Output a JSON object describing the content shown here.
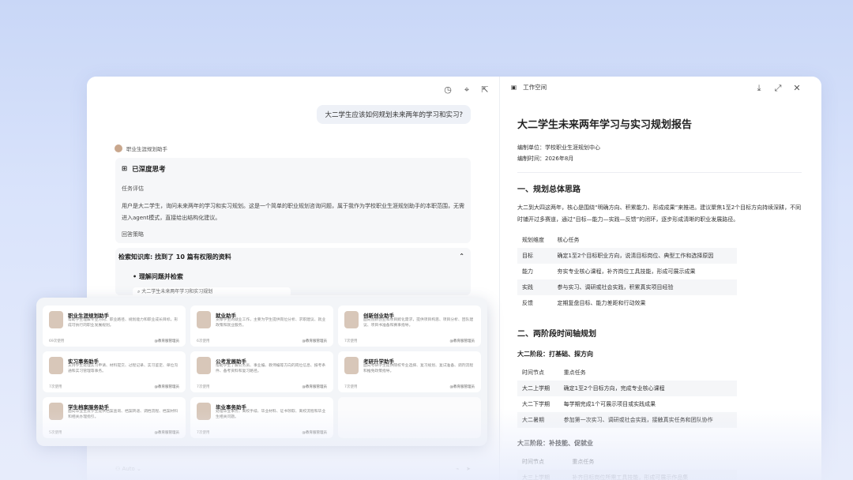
{
  "chat": {
    "user_message": "大二学生应该如何规划未来两年的学习和实习?",
    "assistant_name": "职业生涯规划助手",
    "think_title": "已深度思考",
    "task_label": "任务评估",
    "task_text": "用户是大二学生，询问未来两年的学习和实习规划。这是一个简单的职业规划咨询问题，属于我作为学校职业生涯规划助手的本职范围，无需进入agent模式，直接给出结构化建议。",
    "strategy_label": "回答策略",
    "kb_prefix": "检索知识库:",
    "kb_result": "找到了 10 篇有权限的资料",
    "kb_step": "理解问题并检索",
    "kb_query": "大二学生未来两年学习和实习规划",
    "composer_mode": "Auto"
  },
  "assistants": [
    {
      "name": "职业生涯规划助手",
      "desc": "帮助学生理解专业方向、职业路径、规划能力和职业成长目标，形成可执行的职业发展规划。",
      "meta": "69次使用",
      "tag": "@教育服管理员"
    },
    {
      "name": "就业助手",
      "desc": "支撑学生的就业工作，主要为学生提供岗位分析、求职建议、就业政策和就业服务。",
      "meta": "6次使用",
      "tag": "@教育服管理员"
    },
    {
      "name": "创新创业助手",
      "desc": "面向创新创业和项目孵化需求，提供项目构思、项目分析、团队建议、项目书准备和赛事指导。",
      "meta": "7次使用",
      "tag": "@教育服管理员"
    },
    {
      "name": "实习事务助手",
      "desc": "支持学生处理实习申请、材料提交、过程记录、实习鉴定、单位沟通和实习管理等事务。",
      "meta": "7次使用",
      "tag": "@教育服管理员"
    },
    {
      "name": "公考发展助手",
      "desc": "帮助学生了解公务员、事业编、教师编等方向的岗位信息、报考条件、备考资料和复习路径。",
      "meta": "7次使用",
      "tag": "@教育服管理员"
    },
    {
      "name": "考研升学助手",
      "desc": "面向考研学生提供院校专业选择、复习规划、复试准备、调剂流程和推免政策指导。",
      "meta": "7次使用",
      "tag": "@教育服管理员"
    },
    {
      "name": "学生档案服务助手",
      "desc": "面向毕业生及学生提供档案查询、档案转递、调档流程、档案材料和相关办理指引。",
      "meta": "5次使用",
      "tag": "@教育服管理员"
    },
    {
      "name": "毕业事务助手",
      "desc": "处理毕业事务，离校手续、毕业材料、证书领取、离校流程和毕业生相关问题。",
      "meta": "7次使用",
      "tag": "@教育服管理员"
    }
  ],
  "workspace": {
    "label": "工作空间",
    "title": "大二学生未来两年学习与实习规划报告",
    "org": "编制单位：学校职业生涯规划中心",
    "date": "编制时间：2026年8月",
    "s1": "一、规划总体思路",
    "s1_text": "大二到大四这两年，核心是围绕“明确方向、积累能力、形成成果”来推进。建议聚焦1至2个目标方向持续深耕，不同时铺开过多赛道，通过“目标—能力—实践—反馈”的闭环，逐步形成清晰的职业发展路径。",
    "t1_head": [
      "规划维度",
      "核心任务"
    ],
    "t1_rows": [
      [
        "目标",
        "确定1至2个目标职业方向，说清目标岗位、典型工作和选择原因"
      ],
      [
        "能力",
        "夯实专业核心课程，补齐岗位工具技能，形成可展示成果"
      ],
      [
        "实践",
        "参与实习、调研或社会实践，积累真实项目经验"
      ],
      [
        "反馈",
        "定期复盘目标、能力差距和行动效果"
      ]
    ],
    "s2": "二、两阶段时间轴规划",
    "stage1": "大二阶段：打基础、探方向",
    "t2_head": [
      "时间节点",
      "重点任务"
    ],
    "t2_rows": [
      [
        "大二上学期",
        "确定1至2个目标方向，完成专业核心课程"
      ],
      [
        "大二下学期",
        "每学期完成1个可展示项目或实践成果"
      ],
      [
        "大二暑期",
        "参加第一次实习、调研或社会实践，接触真实任务和团队协作"
      ]
    ],
    "stage2": "大三阶段：补技能、促就业",
    "t3_head": [
      "时间节点",
      "重点任务"
    ],
    "t3_rows": [
      [
        "大三上学期",
        "补齐目标岗位所需工具技能，形成可展示作品集"
      ]
    ]
  }
}
